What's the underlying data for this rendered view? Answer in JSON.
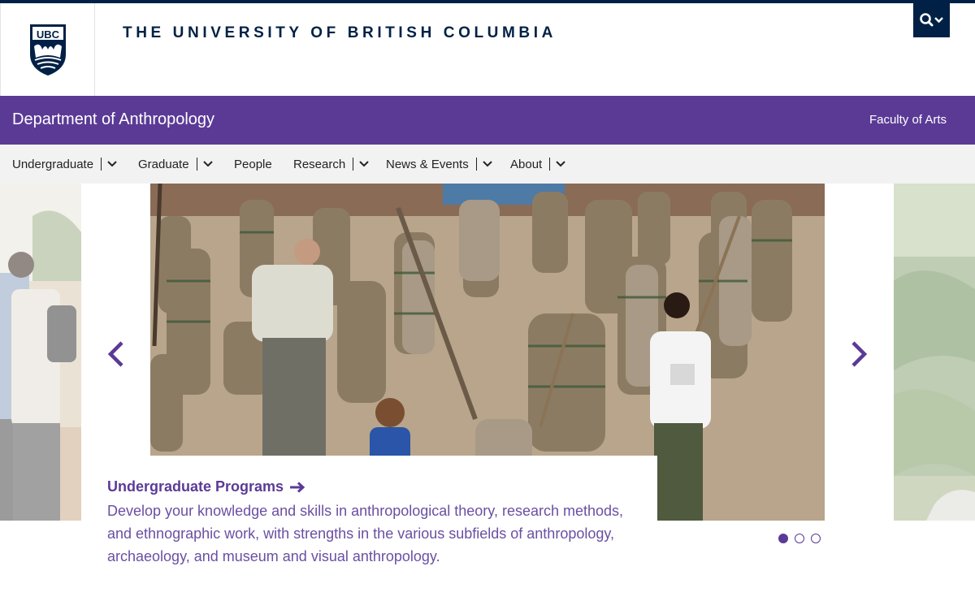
{
  "site": {
    "wordmark": "THE UNIVERSITY OF BRITISH COLUMBIA",
    "logo_text": "UBC",
    "search_icon": "search-icon",
    "brand_navy": "#002145",
    "brand_purple": "#5b3a96"
  },
  "unit": {
    "name": "Department of Anthropology",
    "faculty": "Faculty of Arts"
  },
  "nav": {
    "items": [
      {
        "label": "Undergraduate",
        "has_dropdown": true
      },
      {
        "label": "Graduate",
        "has_dropdown": true
      },
      {
        "label": "People",
        "has_dropdown": false
      },
      {
        "label": "Research",
        "has_dropdown": true
      },
      {
        "label": "News & Events",
        "has_dropdown": true
      },
      {
        "label": "About",
        "has_dropdown": true
      }
    ]
  },
  "carousel": {
    "slide_title": "Undergraduate Programs",
    "slide_text": "Develop your knowledge and skills in anthropological theory, research methods, and ethnographic work, with strengths in the various subfields of anthropology, archaeology, and museum and visual anthropology.",
    "slide_count": 3,
    "active_slide": 1,
    "prev_icon": "chevron-left-icon",
    "next_icon": "chevron-right-icon"
  }
}
